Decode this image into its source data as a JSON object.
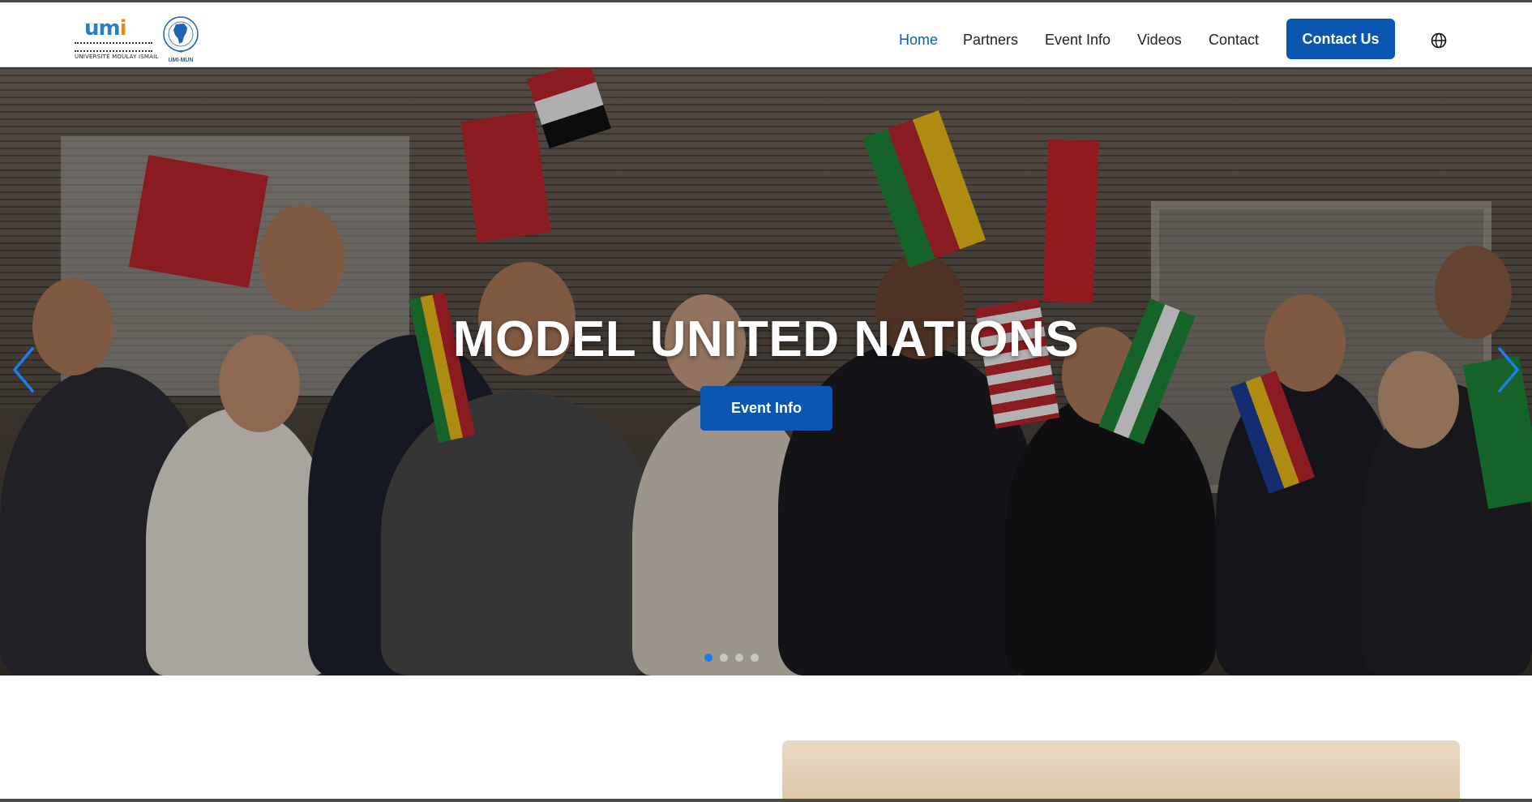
{
  "header": {
    "logo_text_small": "UNIVERSITÉ MOULAY ISMAIL",
    "logo_mark": "umi",
    "mun_logo_text": "UMI-MUN"
  },
  "nav": {
    "items": [
      {
        "label": "Home",
        "active": true
      },
      {
        "label": "Partners",
        "active": false
      },
      {
        "label": "Event Info",
        "active": false
      },
      {
        "label": "Videos",
        "active": false
      },
      {
        "label": "Contact",
        "active": false
      }
    ],
    "cta_label": "Contact Us",
    "language_icon": "globe-icon"
  },
  "hero": {
    "title": "MODEL UNITED NATIONS",
    "button_label": "Event Info",
    "prev_icon": "chevron-left-icon",
    "next_icon": "chevron-right-icon",
    "slide_count": 4,
    "active_slide": 1
  },
  "colors": {
    "primary": "#0a56b0",
    "nav_active": "#0a5fb4",
    "dot_active": "#1a7ff0"
  }
}
